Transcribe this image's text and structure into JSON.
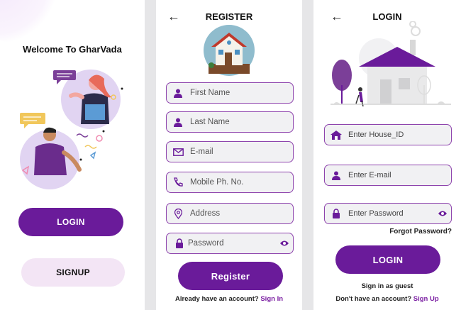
{
  "welcome": {
    "title": "Welcome To GharVada",
    "login_label": "LOGIN",
    "signup_label": "SIGNUP"
  },
  "register": {
    "title": "REGISTER",
    "fields": {
      "first_name": "First Name",
      "last_name": "Last Name",
      "email": "E-mail",
      "mobile": "Mobile Ph. No.",
      "address": "Address",
      "password": "Password"
    },
    "submit_label": "Register",
    "footer_text": "Already have an account?",
    "footer_link": "Sign In"
  },
  "login": {
    "title": "LOGIN",
    "fields": {
      "house_id": "Enter House_ID",
      "email": "Enter E-mail",
      "password": "Enter Password"
    },
    "forgot_label": "Forgot Password?",
    "submit_label": "LOGIN",
    "guest_label": "Sign in as guest",
    "footer_text": "Don't have an account?",
    "footer_link": "Sign Up"
  },
  "colors": {
    "accent": "#6a1b9a",
    "accent_light": "#f3e5f5",
    "field_border": "#8e44ad",
    "field_bg": "#f1f1f3",
    "link": "#7b1fa2"
  },
  "icons": [
    "back-arrow-icon",
    "person-icon",
    "mail-icon",
    "phone-icon",
    "location-pin-icon",
    "lock-icon",
    "eye-icon",
    "house-icon"
  ]
}
